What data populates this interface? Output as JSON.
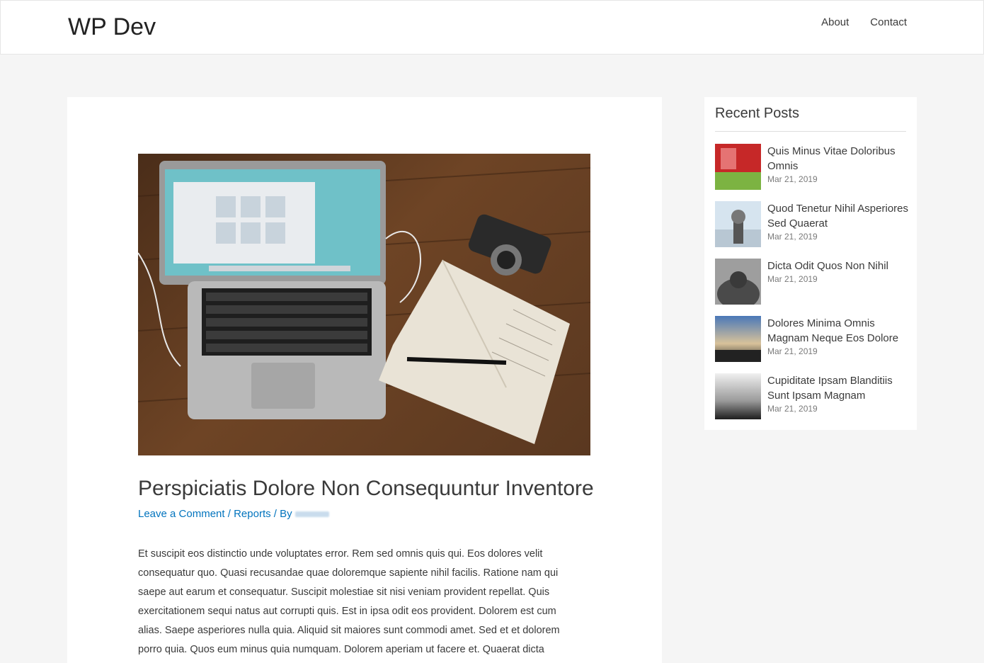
{
  "header": {
    "site_title": "WP Dev",
    "nav": [
      {
        "label": "About"
      },
      {
        "label": "Contact"
      }
    ]
  },
  "article": {
    "title": "Perspiciatis Dolore Non Consequuntur Inventore",
    "meta": {
      "comment_link": "Leave a Comment",
      "separator1": "/",
      "category": "Reports",
      "separator2": "/ By"
    },
    "excerpt": "Et suscipit eos distinctio unde voluptates error. Rem sed omnis quis qui. Eos dolores velit consequatur quo. Quasi recusandae quae doloremque sapiente nihil facilis. Ratione nam qui saepe aut earum et consequatur. Suscipit molestiae sit nisi veniam provident repellat. Quis exercitationem sequi natus aut corrupti quis. Est in ipsa odit eos provident. Dolorem est cum alias. Saepe asperiores nulla quia. Aliquid sit maiores sunt commodi amet. Sed et et dolorem porro quia. Quos eum minus quia numquam. Dolorem aperiam ut facere et. Quaerat dicta"
  },
  "sidebar": {
    "widget_title": "Recent Posts",
    "recent_posts": [
      {
        "title": "Quis Minus Vitae Doloribus Omnis",
        "date": "Mar 21, 2019"
      },
      {
        "title": "Quod Tenetur Nihil Asperiores Sed Quaerat",
        "date": "Mar 21, 2019"
      },
      {
        "title": "Dicta Odit Quos Non Nihil",
        "date": "Mar 21, 2019"
      },
      {
        "title": "Dolores Minima Omnis Magnam Neque Eos Dolore",
        "date": "Mar 21, 2019"
      },
      {
        "title": "Cupiditate Ipsam Blanditiis Sunt Ipsam Magnam",
        "date": "Mar 21, 2019"
      }
    ]
  },
  "colors": {
    "accent_link": "#0274be",
    "text": "#3a3a3a",
    "background": "#f5f5f5"
  }
}
